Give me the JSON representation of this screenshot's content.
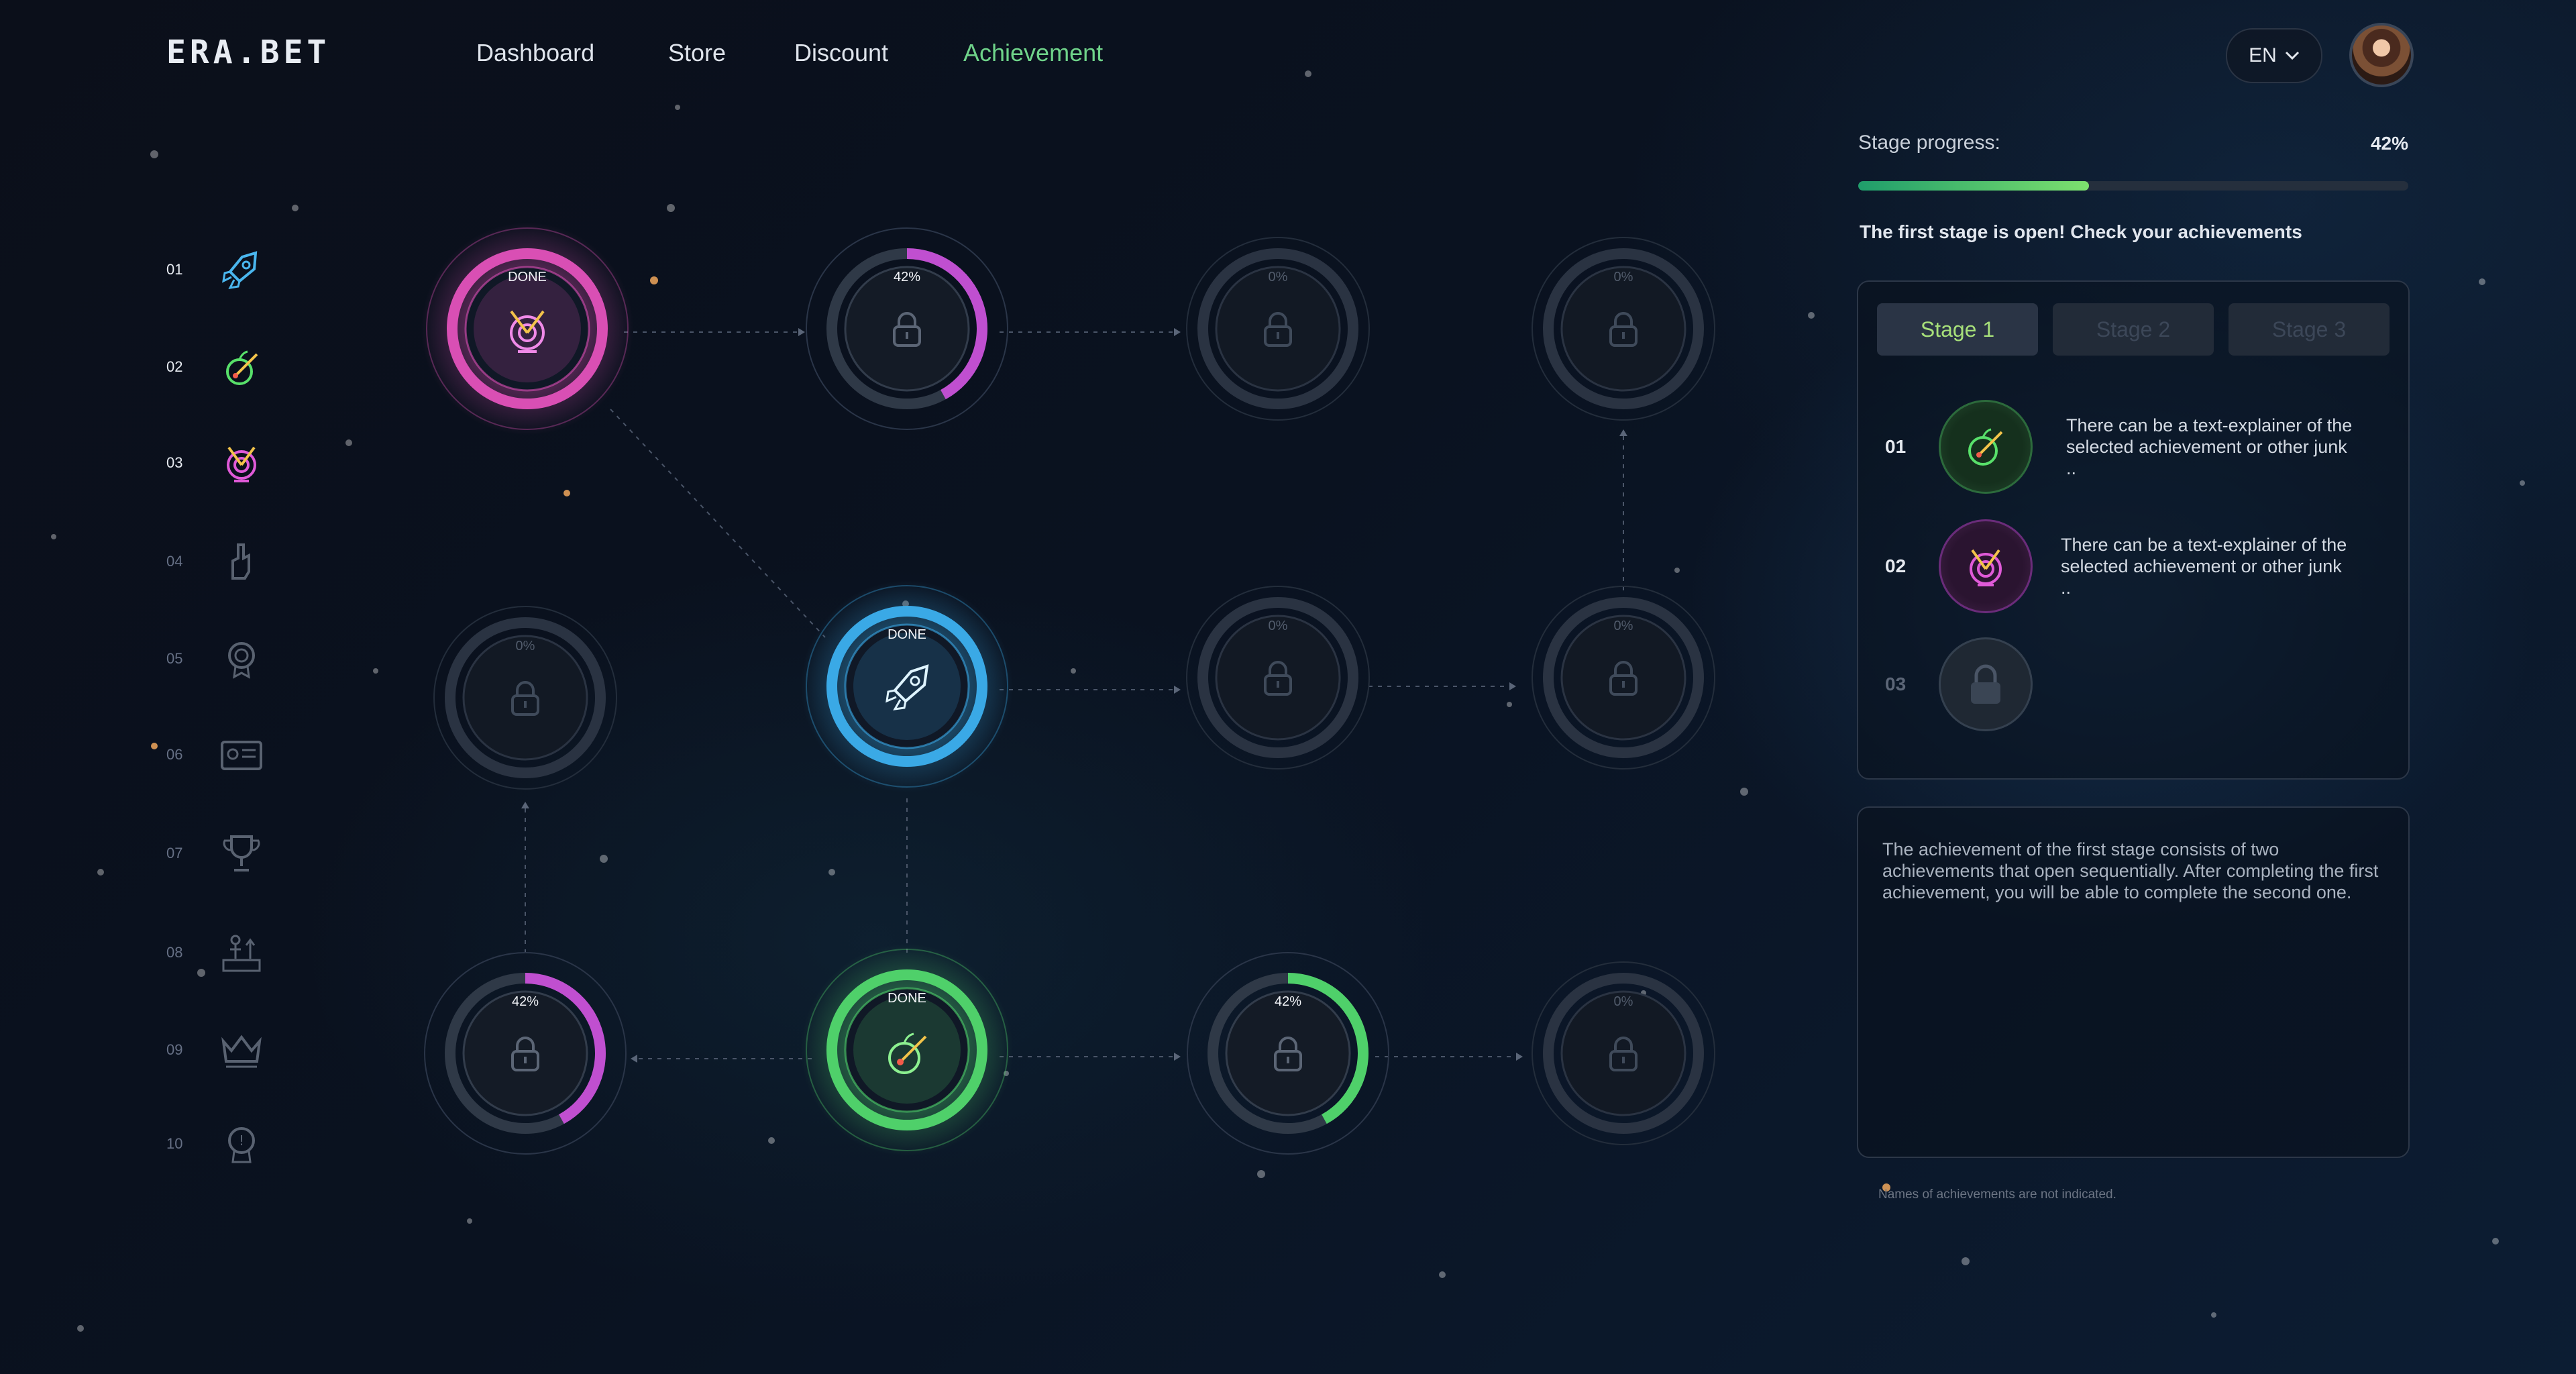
{
  "header": {
    "logo": "ERA.BET",
    "nav": [
      {
        "label": "Dashboard",
        "active": false
      },
      {
        "label": "Store",
        "active": false
      },
      {
        "label": "Discount",
        "active": false
      },
      {
        "label": "Achievement",
        "active": true
      }
    ],
    "language": "EN",
    "avatar_icon": "user-avatar"
  },
  "stages_nav": [
    {
      "num": "01",
      "icon": "rocket-icon",
      "active": true
    },
    {
      "num": "02",
      "icon": "apple-arrow-icon",
      "active": true
    },
    {
      "num": "03",
      "icon": "target-icon",
      "active": true
    },
    {
      "num": "04",
      "icon": "hand-icon",
      "active": false
    },
    {
      "num": "05",
      "icon": "medal-icon",
      "active": false
    },
    {
      "num": "06",
      "icon": "id-card-icon",
      "active": false
    },
    {
      "num": "07",
      "icon": "trophy-icon",
      "active": false
    },
    {
      "num": "08",
      "icon": "podium-icon",
      "active": false
    },
    {
      "num": "09",
      "icon": "crown-icon",
      "active": false
    },
    {
      "num": "10",
      "icon": "badge-icon",
      "active": false
    }
  ],
  "tree_nodes": [
    {
      "id": "n1",
      "label": "DONE",
      "state": "done",
      "color": "#d94fb4",
      "icon": "target-icon"
    },
    {
      "id": "n2",
      "label": "42%",
      "state": "progress",
      "progress": 0.42,
      "color": "#c04fd0"
    },
    {
      "id": "n3",
      "label": "0%",
      "state": "locked"
    },
    {
      "id": "n4",
      "label": "0%",
      "state": "locked"
    },
    {
      "id": "n5",
      "label": "0%",
      "state": "locked"
    },
    {
      "id": "n6",
      "label": "DONE",
      "state": "done",
      "color": "#3aa9e6",
      "icon": "rocket-icon"
    },
    {
      "id": "n7",
      "label": "0%",
      "state": "locked"
    },
    {
      "id": "n8",
      "label": "0%",
      "state": "locked"
    },
    {
      "id": "n9",
      "label": "42%",
      "state": "progress",
      "progress": 0.42,
      "color": "#c04fd0"
    },
    {
      "id": "n10",
      "label": "DONE",
      "state": "done",
      "color": "#4fd06a",
      "icon": "apple-arrow-icon"
    },
    {
      "id": "n11",
      "label": "42%",
      "state": "progress",
      "progress": 0.42,
      "color": "#4fd06a"
    },
    {
      "id": "n12",
      "label": "0%",
      "state": "locked"
    }
  ],
  "panel": {
    "progress_label": "Stage progress:",
    "progress_value": "42%",
    "progress_fraction": 0.42,
    "message": "The first stage is open! Check your achievements",
    "tabs": [
      {
        "label": "Stage 1",
        "active": true
      },
      {
        "label": "Stage 2",
        "active": false
      },
      {
        "label": "Stage 3",
        "active": false
      }
    ],
    "achievements": [
      {
        "num": "01",
        "icon": "apple-arrow-icon",
        "text": "There can be a text-explainer of the selected achievement or other junk .."
      },
      {
        "num": "02",
        "icon": "target-icon",
        "text": "There can be a text-explainer of the selected achievement or other junk .."
      },
      {
        "num": "03",
        "icon": "lock-icon",
        "text": ""
      }
    ],
    "description": "The achievement of the first stage consists of two achievements that open sequentially. After completing the first achievement, you will be able to complete the second one.",
    "footnote": "Names of achievements are not indicated."
  },
  "colors": {
    "accent": "#6fd38a",
    "pink": "#d94fb4",
    "blue": "#3aa9e6",
    "green": "#4fd06a"
  }
}
